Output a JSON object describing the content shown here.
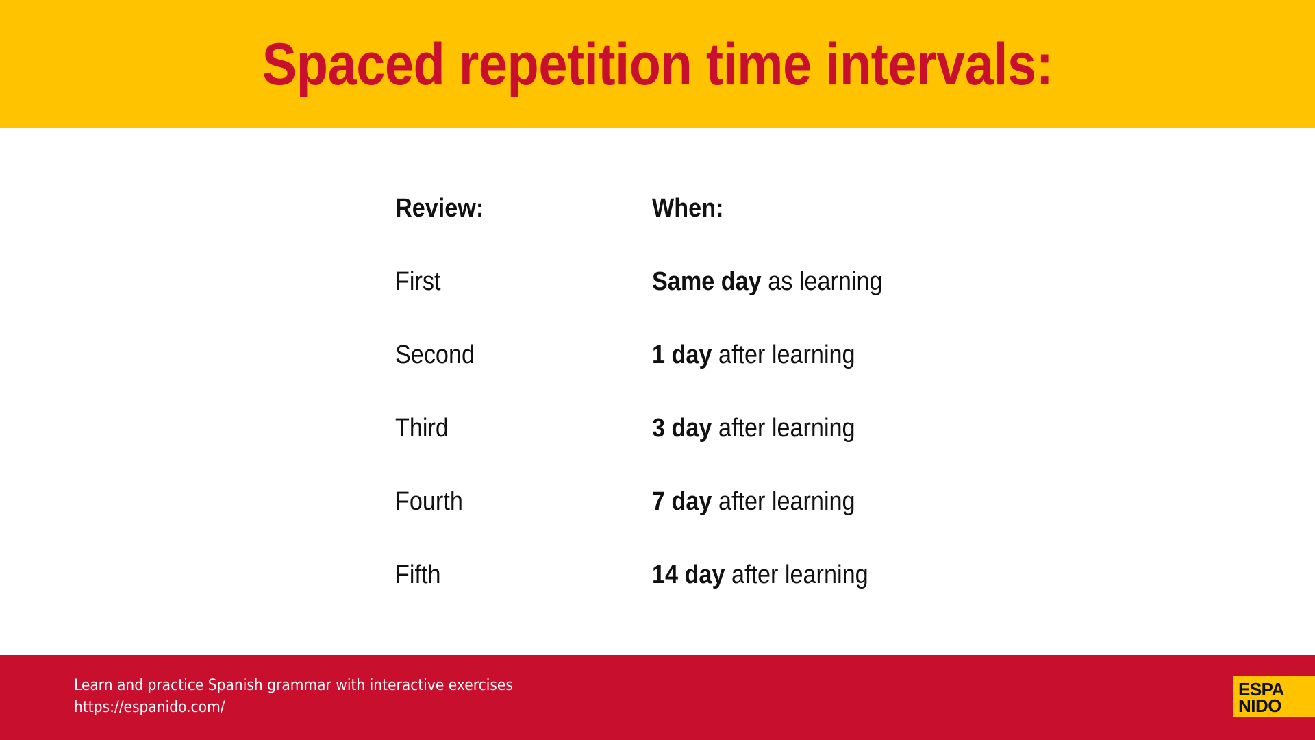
{
  "header": {
    "title": "Spaced repetition time intervals:"
  },
  "table": {
    "headers": [
      "Review:",
      "When:"
    ],
    "rows": [
      {
        "review": "First",
        "when_bold": "Same day",
        "when_rest": " as learning"
      },
      {
        "review": "Second",
        "when_bold": "1 day",
        "when_rest": " after learning"
      },
      {
        "review": "Third",
        "when_bold": "3 day",
        "when_rest": " after learning"
      },
      {
        "review": "Fourth",
        "when_bold": "7 day",
        "when_rest": " after learning"
      },
      {
        "review": "Fifth",
        "when_bold": "14 day",
        "when_rest": " after learning"
      }
    ]
  },
  "footer": {
    "tagline": "Learn and practice Spanish grammar with interactive exercises",
    "url": "https://espanido.com/",
    "logo_line1": "ESPA",
    "logo_line2": "NIDO"
  },
  "colors": {
    "header_bg": "#ffc300",
    "title_red": "#c8102e",
    "footer_bg": "#c8102e",
    "text": "#111111"
  }
}
